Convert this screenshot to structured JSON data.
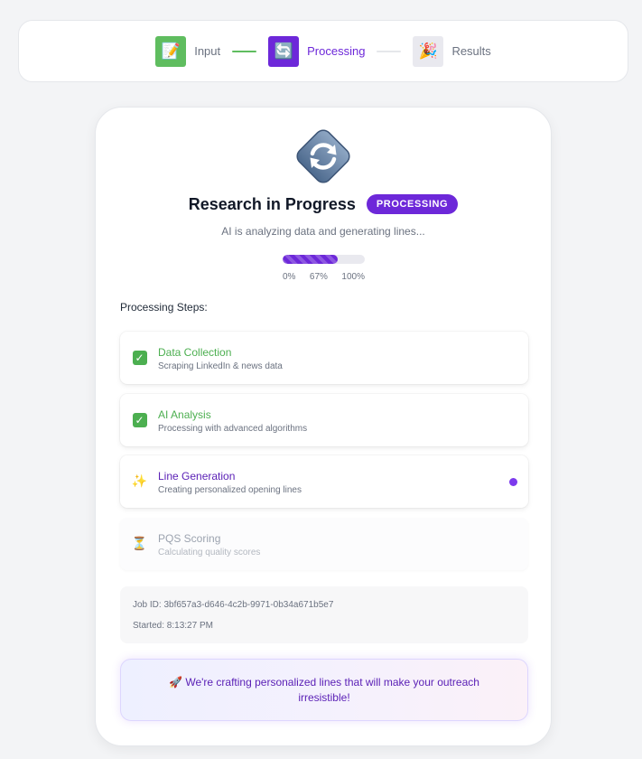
{
  "stepper": {
    "steps": [
      {
        "label": "Input",
        "icon": "memo-icon",
        "glyph": "📝",
        "state": "done"
      },
      {
        "label": "Processing",
        "icon": "refresh-icon",
        "glyph": "🔄",
        "state": "active"
      },
      {
        "label": "Results",
        "icon": "party-popper-icon",
        "glyph": "🎉",
        "state": "todo"
      }
    ]
  },
  "status": {
    "title": "Research in Progress",
    "badge": "PROCESSING",
    "subtitle": "AI is analyzing data and generating lines..."
  },
  "progress": {
    "value": 0.67,
    "labels": [
      "0%",
      "67%",
      "100%"
    ]
  },
  "processing": {
    "heading": "Processing Steps:",
    "steps": [
      {
        "title": "Data Collection",
        "description": "Scraping LinkedIn & news data",
        "state": "completed",
        "icon": "check-box-icon"
      },
      {
        "title": "AI Analysis",
        "description": "Processing with advanced algorithms",
        "state": "completed",
        "icon": "check-box-icon"
      },
      {
        "title": "Line Generation",
        "description": "Creating personalized opening lines",
        "state": "active",
        "icon": "sparkles-icon"
      },
      {
        "title": "PQS Scoring",
        "description": "Calculating quality scores",
        "state": "pending",
        "icon": "hourglass-icon"
      }
    ]
  },
  "job": {
    "id_text": "Job ID: 3bf657a3-d646-4c2b-9971-0b34a671b5e7",
    "started_text": "Started: 8:13:27 PM"
  },
  "message": {
    "text": "🚀 We're crafting personalized lines that will make your outreach irresistible!"
  },
  "colors": {
    "accent": "#6d28d9",
    "success": "#4caf50",
    "muted": "#6b7280"
  }
}
